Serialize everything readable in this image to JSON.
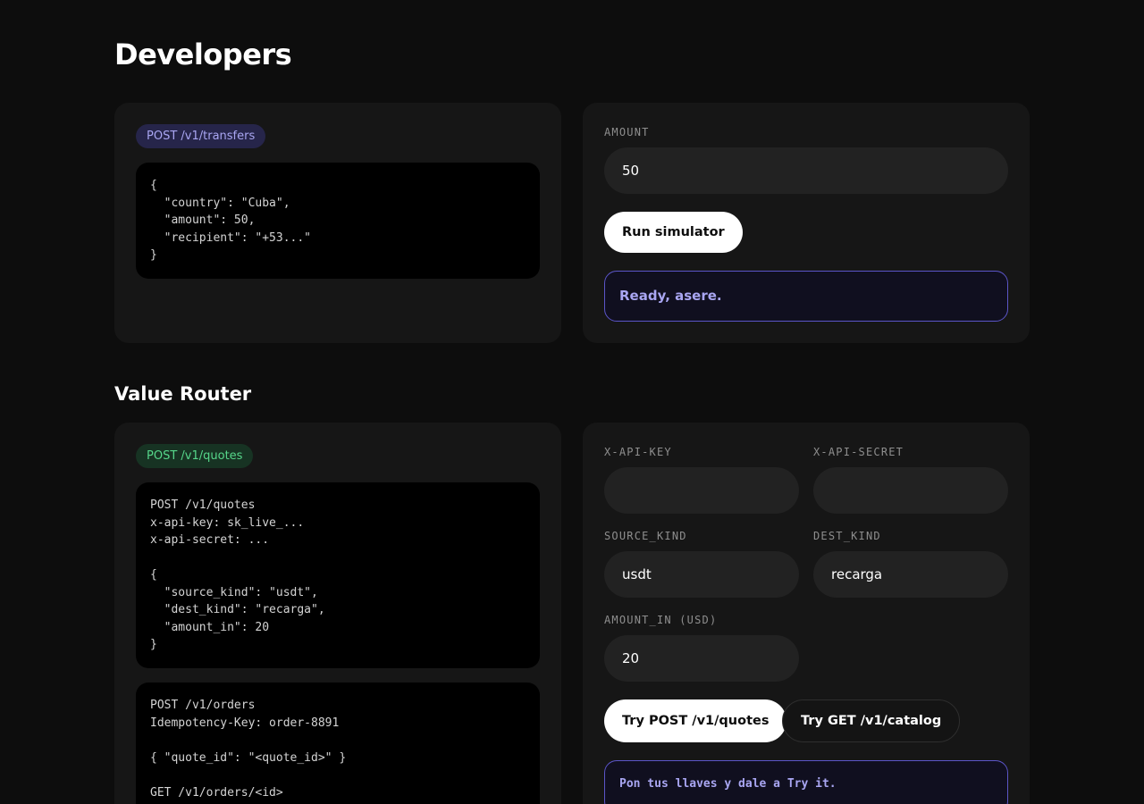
{
  "page": {
    "title": "Developers"
  },
  "transfers": {
    "badge": "POST /v1/transfers",
    "code": "{\n  \"country\": \"Cuba\",\n  \"amount\": 50,\n  \"recipient\": \"+53...\"\n}",
    "amount_label": "AMOUNT",
    "amount_value": "50",
    "run_button": "Run simulator",
    "status": "Ready, asere."
  },
  "router": {
    "title": "Value Router",
    "badge": "POST /v1/quotes",
    "code_quote": "POST /v1/quotes\nx-api-key: sk_live_...\nx-api-secret: ...\n\n{\n  \"source_kind\": \"usdt\",\n  \"dest_kind\": \"recarga\",\n  \"amount_in\": 20\n}",
    "code_orders": "POST /v1/orders\nIdempotency-Key: order-8891\n\n{ \"quote_id\": \"<quote_id>\" }\n\nGET /v1/orders/<id>",
    "api_key_label": "X-API-KEY",
    "api_key_value": "",
    "api_secret_label": "X-API-SECRET",
    "api_secret_value": "",
    "source_kind_label": "SOURCE_KIND",
    "source_kind_value": "usdt",
    "dest_kind_label": "DEST_KIND",
    "dest_kind_value": "recarga",
    "amount_in_label": "AMOUNT_IN (USD)",
    "amount_in_value": "20",
    "try_quotes_button": "Try POST /v1/quotes",
    "try_catalog_button": "Try GET /v1/catalog",
    "status": "Pon tus llaves y dale a Try it."
  },
  "colors": {
    "background": "#0d0d0d",
    "card": "#161616",
    "accent_purple": "#5b55c8",
    "accent_green": "#56d68a"
  }
}
